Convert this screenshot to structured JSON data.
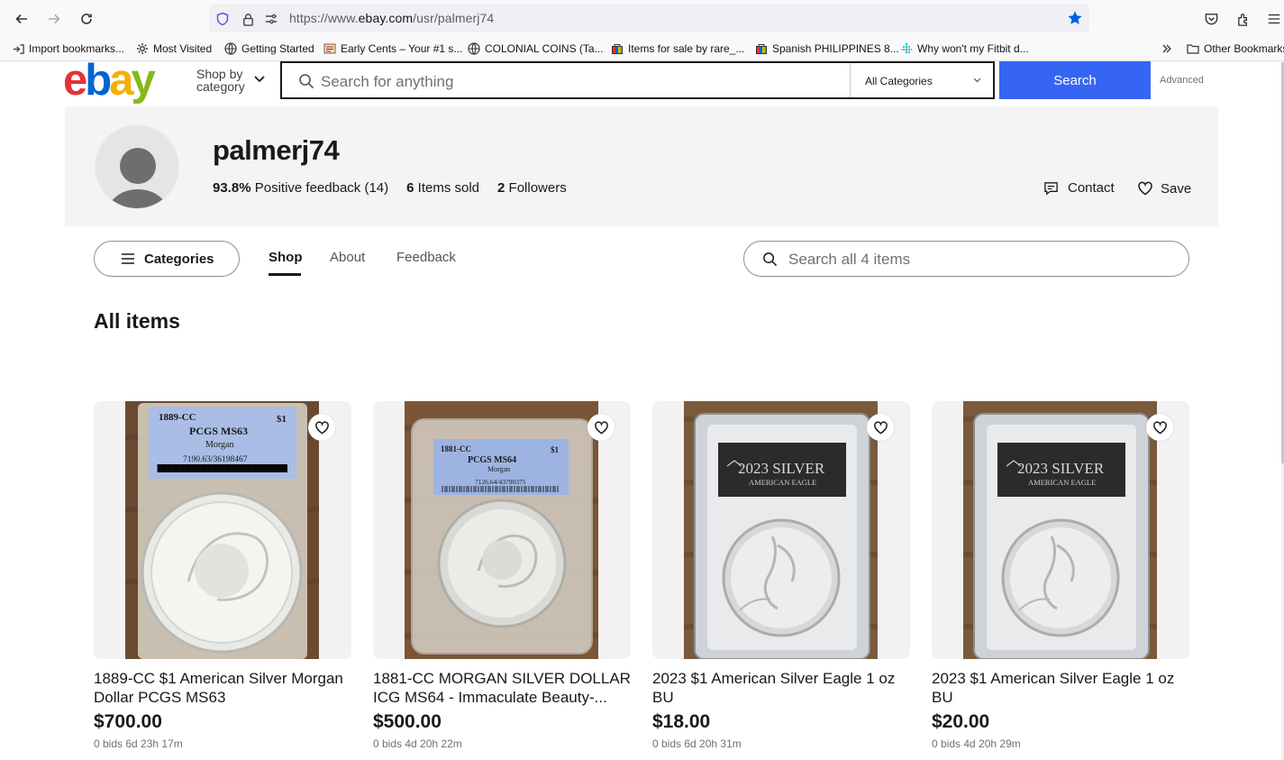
{
  "browser": {
    "url_prefix": "https://www.",
    "url_domain": "ebay.com",
    "url_path": "/usr/palmerj74",
    "bookmarks": [
      {
        "label": "Import bookmarks...",
        "icon": "import-icon"
      },
      {
        "label": "Most Visited",
        "icon": "gear-icon"
      },
      {
        "label": "Getting Started",
        "icon": "globe-icon"
      },
      {
        "label": "Early Cents – Your #1 s...",
        "icon": "site-favicon"
      },
      {
        "label": "COLONIAL COINS (Ta...",
        "icon": "globe-icon"
      },
      {
        "label": "Items for sale by rare_...",
        "icon": "ebay-favicon"
      },
      {
        "label": "Spanish PHILIPPINES 8...",
        "icon": "ebay-favicon"
      },
      {
        "label": "Why won't my Fitbit d...",
        "icon": "fitbit-favicon"
      }
    ],
    "other_bookmarks": "Other Bookmarks"
  },
  "header": {
    "logo_e": "e",
    "logo_b": "b",
    "logo_a": "a",
    "logo_y": "y",
    "shop_by": "Shop by category",
    "search_placeholder": "Search for anything",
    "category_select": "All Categories",
    "search_button": "Search",
    "advanced": "Advanced"
  },
  "seller": {
    "name": "palmerj74",
    "feedback_pct": "93.8%",
    "feedback_text": "Positive feedback (14)",
    "items_sold_count": "6",
    "items_sold_text": "Items sold",
    "followers_count": "2",
    "followers_text": "Followers",
    "contact": "Contact",
    "save": "Save"
  },
  "tabs": {
    "categories": "Categories",
    "shop": "Shop",
    "about": "About",
    "feedback": "Feedback",
    "store_search_placeholder": "Search all 4 items"
  },
  "main": {
    "section_title": "All items",
    "items": [
      {
        "title": "1889-CC $1 American Silver Morgan Dollar PCGS MS63",
        "price": "$700.00",
        "meta": "0 bids 6d 23h 17m"
      },
      {
        "title": "1881-CC MORGAN SILVER DOLLAR ICG MS64 - Immaculate Beauty-...",
        "price": "$500.00",
        "meta": "0 bids 4d 20h 22m"
      },
      {
        "title": "2023 $1 American Silver Eagle 1 oz BU",
        "price": "$18.00",
        "meta": "0 bids 6d 20h 31m"
      },
      {
        "title": "2023 $1 American Silver Eagle 1 oz BU",
        "price": "$20.00",
        "meta": "0 bids 4d 20h 29m"
      }
    ],
    "slab_labels": [
      {
        "line1": "1889-CC",
        "line1b": "$1",
        "line2": "PCGS MS63",
        "line3": "Morgan",
        "line4": "7190.63/36198467"
      },
      {
        "line1": "1881-CC",
        "line1b": "$1",
        "line2": "PCGS MS64",
        "line3": "Morgan",
        "line4": "7126.64/43790375"
      },
      {
        "line1": "2023 SILVER",
        "line2": "AMERICAN EAGLE"
      },
      {
        "line1": "2023 SILVER",
        "line2": "AMERICAN EAGLE"
      }
    ]
  },
  "colors": {
    "search_blue": "#3665f3",
    "ebay_red": "#e53238",
    "ebay_blue": "#0064d2",
    "ebay_yellow": "#f5af02",
    "ebay_green": "#86b817"
  }
}
